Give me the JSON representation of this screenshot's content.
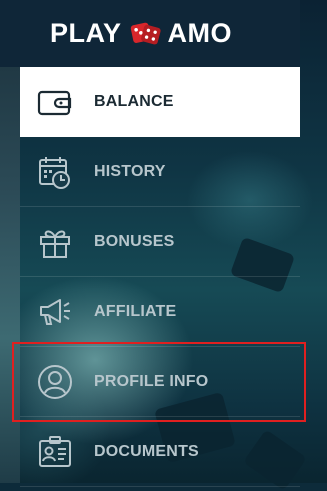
{
  "brand": {
    "left": "PLAY",
    "right": "AMO",
    "dice_color": "#d8262b"
  },
  "menu": {
    "items": [
      {
        "label": "BALANCE",
        "icon": "wallet-icon",
        "active": true
      },
      {
        "label": "HISTORY",
        "icon": "calendar-clock-icon",
        "active": false
      },
      {
        "label": "BONUSES",
        "icon": "gift-icon",
        "active": false
      },
      {
        "label": "AFFILIATE",
        "icon": "megaphone-icon",
        "active": false
      },
      {
        "label": "PROFILE INFO",
        "icon": "user-circle-icon",
        "active": false,
        "highlighted": true
      },
      {
        "label": "DOCUMENTS",
        "icon": "id-card-icon",
        "active": false
      }
    ]
  },
  "colors": {
    "active_bg": "#ffffff",
    "active_text": "#1b2a33",
    "inactive_text": "#b7c6cc",
    "highlight_border": "#e02020"
  }
}
